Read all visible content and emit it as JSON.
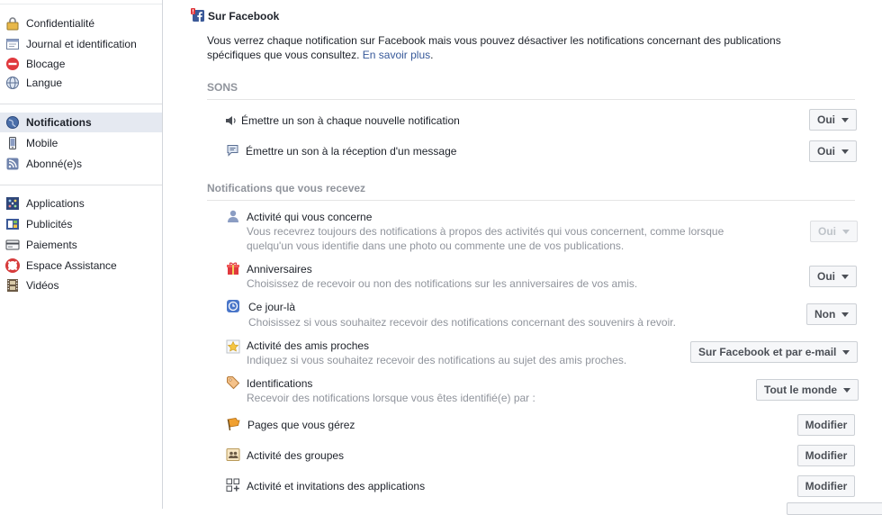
{
  "sidebar": {
    "groups": [
      [
        {
          "label": "Confidentialité",
          "icon": "padlock-icon"
        },
        {
          "label": "Journal et identification",
          "icon": "timeline-icon"
        },
        {
          "label": "Blocage",
          "icon": "block-icon"
        },
        {
          "label": "Langue",
          "icon": "globe-icon"
        }
      ],
      [
        {
          "label": "Notifications",
          "icon": "notifications-globe-icon",
          "active": true
        },
        {
          "label": "Mobile",
          "icon": "mobile-icon"
        },
        {
          "label": "Abonné(e)s",
          "icon": "rss-icon"
        }
      ],
      [
        {
          "label": "Applications",
          "icon": "apps-icon"
        },
        {
          "label": "Publicités",
          "icon": "ads-icon"
        },
        {
          "label": "Paiements",
          "icon": "credit-card-icon"
        },
        {
          "label": "Espace Assistance",
          "icon": "lifebuoy-icon"
        },
        {
          "label": "Vidéos",
          "icon": "film-icon"
        }
      ]
    ]
  },
  "main": {
    "section_title": "Sur Facebook",
    "section_icon": "facebook-notification-icon",
    "intro": "Vous verrez chaque notification sur Facebook mais vous pouvez désactiver les notifications concernant des publications spécifiques que vous consultez.",
    "learn_more": "En savoir plus",
    "learn_more_suffix": ".",
    "sounds_heading": "SONS",
    "sounds": [
      {
        "label": "Émettre un son à chaque nouvelle notification",
        "icon": "speaker-icon",
        "value": "Oui"
      },
      {
        "label": "Émettre un son à la réception d'un message",
        "icon": "message-bubble-icon",
        "value": "Oui"
      }
    ],
    "received_heading": "Notifications que vous recevez",
    "notifications": [
      {
        "title": "Activité qui vous concerne",
        "icon": "person-icon",
        "desc": [
          "Vous recevrez toujours des notifications à propos des activités qui vous concernent, comme lorsque",
          "quelqu'un vous identifie dans une photo ou commente une de vos publications."
        ],
        "value": "Oui",
        "disabled": true
      },
      {
        "title": "Anniversaires",
        "icon": "gift-icon",
        "desc": [
          "Choisissez de recevoir ou non des notifications sur les anniversaires de vos amis."
        ],
        "value": "Oui"
      },
      {
        "title": "Ce jour-là",
        "icon": "clock-icon",
        "desc": [
          "Choisissez si vous souhaitez recevoir des notifications concernant des souvenirs à revoir."
        ],
        "value": "Non"
      },
      {
        "title": "Activité des amis proches",
        "icon": "star-icon",
        "desc": [
          "Indiquez si vous souhaitez recevoir des notifications au sujet des amis proches."
        ],
        "value": "Sur Facebook et par e-mail"
      },
      {
        "title": "Identifications",
        "icon": "tag-icon",
        "desc": [
          "Recevoir des notifications lorsque vous êtes identifié(e) par :"
        ],
        "value": "Tout le monde"
      }
    ],
    "edit_rows": [
      {
        "title": "Pages que vous gérez",
        "icon": "flag-icon",
        "button": "Modifier"
      },
      {
        "title": "Activité des groupes",
        "icon": "groups-icon",
        "button": "Modifier"
      },
      {
        "title": "Activité et invitations des applications",
        "icon": "apps-invitations-icon",
        "button": "Modifier"
      }
    ]
  }
}
